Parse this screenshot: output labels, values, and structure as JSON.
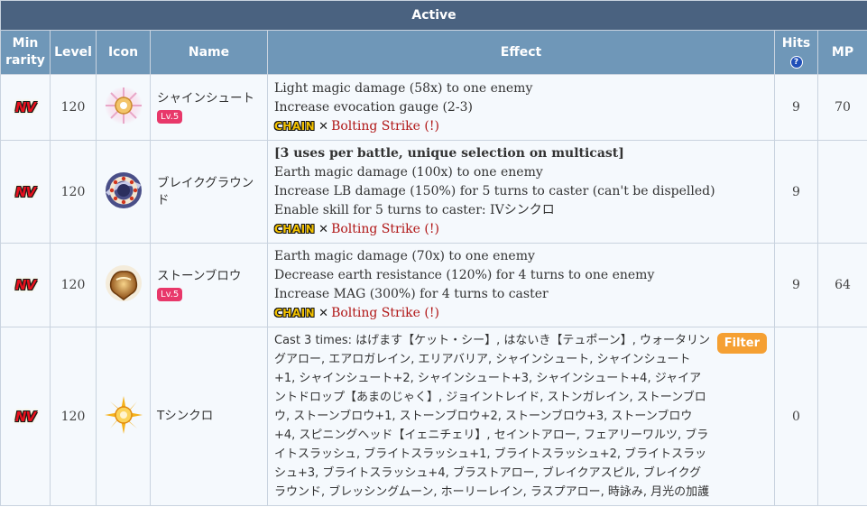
{
  "section_title": "Active",
  "columns": {
    "min_rarity": "Min rarity",
    "level": "Level",
    "icon": "Icon",
    "name": "Name",
    "effect": "Effect",
    "hits": "Hits",
    "hits_help": "?",
    "mp": "MP"
  },
  "rarity_label": "NV",
  "chain_badge": "CHAIN",
  "chain_cross": "✕",
  "filter_label": "Filter",
  "rows": [
    {
      "level": "120",
      "icon": "radiant-light-burst-icon",
      "name": "シャインシュート",
      "badge": "Lv.5",
      "effects": [
        "Light magic damage (58x) to one enemy",
        "Increase evocation gauge (2-3)"
      ],
      "chain_name": "Bolting Strike (!)",
      "hits": "9",
      "mp": "70"
    },
    {
      "level": "120",
      "icon": "earth-ring-icon",
      "name": "ブレイクグラウンド",
      "badge": "",
      "effect_header": "[3 uses per battle, unique selection on multicast]",
      "effects": [
        "Earth magic damage (100x) to one enemy",
        "Increase LB damage (150%) for 5 turns to caster (can't be dispelled)",
        "Enable skill for 5 turns to caster: IVシンクロ"
      ],
      "chain_name": "Bolting Strike (!)",
      "hits": "9",
      "mp": ""
    },
    {
      "level": "120",
      "icon": "stone-fist-icon",
      "name": "ストーンブロウ",
      "badge": "Lv.5",
      "effects": [
        "Earth magic damage (70x) to one enemy",
        "Decrease earth resistance (120%) for 4 turns to one enemy",
        "Increase MAG (300%) for 4 turns to caster"
      ],
      "chain_name": "Bolting Strike (!)",
      "hits": "9",
      "mp": "64"
    },
    {
      "level": "120",
      "icon": "golden-starburst-icon",
      "name": "Tシンクロ",
      "badge": "",
      "long_effect": "Cast 3 times: はげます【ケット・シー】, はないき【テュポーン】, ウォータリングアロー, エアロガレイン, エリアバリア, シャインシュート, シャインシュート+1, シャインシュート+2, シャインシュート+3, シャインシュート+4, ジャイアントドロップ【あまのじゃく】, ジョイントレイド, ストンガレイン, ストーンブロウ, ストーンブロウ+1, ストーンブロウ+2, ストーンブロウ+3, ストーンブロウ+4, スピニングヘッド【イェニチェリ】, セイントアロー, フェアリーワルツ, ブライトスラッシュ, ブライトスラッシュ+1, ブライトスラッシュ+2, ブライトスラッシュ+3, ブライトスラッシュ+4, ブラストアロー, ブレイクアスピル, ブレイクグラウンド, ブレッシングムーン, ホーリーレイン, ラスプアロー, 時詠み, 月光の加護",
      "hits": "0",
      "mp": ""
    }
  ]
}
